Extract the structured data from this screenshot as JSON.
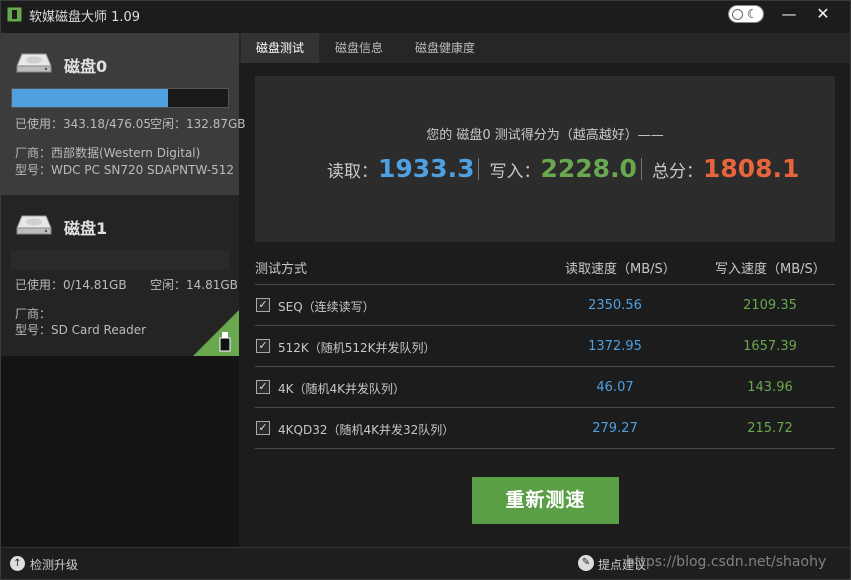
{
  "window": {
    "title": "软媒磁盘大师 1.09",
    "minimize_glyph": "—",
    "close_glyph": "✕"
  },
  "sidebar": {
    "disks": [
      {
        "name": "磁盘0",
        "usage_fraction": 0.7208,
        "used_text": "已使用：343.18/476.05",
        "free_text": "空闲：132.87GB",
        "vendor_text": "厂商：西部数据(Western Digital)",
        "model_text": "型号：WDC PC SN720 SDAPNTW-512",
        "selected": true
      },
      {
        "name": "磁盘1",
        "usage_fraction": 0.0,
        "used_text": "已使用：0/14.81GB",
        "free_text": "空闲：14.81GB",
        "vendor_text": "厂商：",
        "model_text": "型号：SD Card Reader",
        "selected": false
      }
    ]
  },
  "tabs": [
    "磁盘测试",
    "磁盘信息",
    "磁盘健康度"
  ],
  "active_tab": 0,
  "score": {
    "caption": "您的 磁盘0 测试得分为（越高越好）——",
    "read_label": "读取：",
    "read_value": "1933.3",
    "write_label": "写入：",
    "write_value": "2228.0",
    "total_label": "总分：",
    "total_value": "1808.1",
    "colors": {
      "read": "#4ea0e0",
      "write": "#6aa84f",
      "total": "#e8643c"
    }
  },
  "table": {
    "headers": {
      "method": "测试方式",
      "read": "读取速度（MB/S）",
      "write": "写入速度（MB/S）"
    },
    "rows": [
      {
        "checked": true,
        "label": "SEQ（连续读写）",
        "read": "2350.56",
        "write": "2109.35"
      },
      {
        "checked": true,
        "label": "512K（随机512K并发队列）",
        "read": "1372.95",
        "write": "1657.39"
      },
      {
        "checked": true,
        "label": "4K（随机4K并发队列）",
        "read": "46.07",
        "write": "143.96"
      },
      {
        "checked": true,
        "label": "4KQD32（随机4K并发32队列）",
        "read": "279.27",
        "write": "215.72"
      }
    ]
  },
  "retest_label": "重新测速",
  "status": {
    "left_text": "检测升级",
    "right_text": "提点建议",
    "watermark": "https://blog.csdn.net/shaohy"
  }
}
